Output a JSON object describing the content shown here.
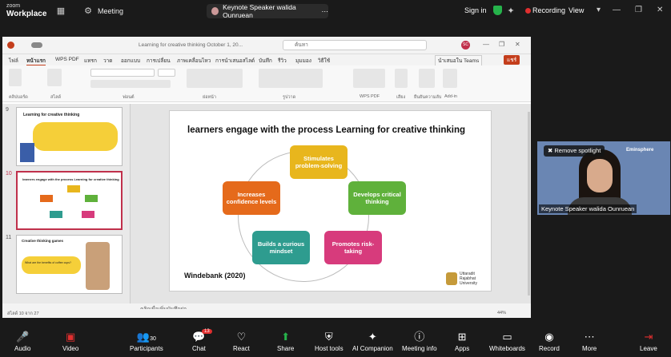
{
  "zoom": {
    "app_line1": "zoom",
    "app_line2": "Workplace",
    "meeting_label": "Meeting",
    "share_title": "Keynote Speaker walida Ounruean",
    "sign_in": "Sign in",
    "recording": "Recording",
    "view": "View",
    "colors": {
      "record": "#e02f2f",
      "shield": "#26b34b"
    }
  },
  "ppt": {
    "window_title": "Learning for creative thinking  October 1, 20...",
    "search_placeholder": "ค้นหา",
    "account_initials": "SC",
    "tabs": [
      "ไฟล์",
      "หน้าแรก",
      "WPS PDF",
      "แทรก",
      "วาด",
      "ออกแบบ",
      "การเปลี่ยน",
      "ภาพเคลื่อนไหว",
      "การนำเสนอสไลด์",
      "บันทึก",
      "รีวิว",
      "มุมมอง",
      "วิธีใช้"
    ],
    "share_btn": "แชร์",
    "teams_btn": "นำเสนอใน Teams",
    "ribbon_groups": [
      "คลิปบอร์ด",
      "สไลด์",
      "ฟอนต์",
      "ย่อหน้า",
      "รูปวาด",
      "WPS PDF",
      "เสียง",
      "ยืนยันความลับ",
      "Add-in"
    ],
    "notes_placeholder": "คลิกเพื่อเพิ่มบันทึกย่อ",
    "status_left": "สไลด์ 10 จาก 27",
    "zoom_level": "44%"
  },
  "thumbnails": [
    {
      "num": "9",
      "title": "Learning for creative thinking"
    },
    {
      "num": "10",
      "title": "learners engage with the process  Learning for creative thinking"
    },
    {
      "num": "11",
      "title": "Creative thinking games",
      "q": "What are the benefits of coffee cups?"
    }
  ],
  "slide": {
    "title": "learners engage with the process  Learning for creative thinking",
    "boxes": [
      {
        "label": "Stimulates problem-solving",
        "color": "#e8b61d"
      },
      {
        "label": "Develops critical thinking",
        "color": "#5fb13b"
      },
      {
        "label": "Promotes risk-taking",
        "color": "#d73b7c"
      },
      {
        "label": "Builds a curious mindset",
        "color": "#2e9c8f"
      },
      {
        "label": "Increases confidence levels",
        "color": "#e56a1b"
      }
    ],
    "citation": "Windebank (2020)",
    "university": "Uttaradit Rajabhat University"
  },
  "speaker": {
    "remove_spotlight": "Remove spotlight",
    "name": "Keynote Speaker walida Ounruean",
    "backdrop_text": "Eminsphere"
  },
  "toolbar": {
    "audio": "Audio",
    "video": "Video",
    "participants": "Participants",
    "participants_count": "30",
    "chat": "Chat",
    "chat_badge": "13",
    "react": "React",
    "share": "Share",
    "host_tools": "Host tools",
    "ai_companion": "AI Companion",
    "meeting_info": "Meeting info",
    "apps": "Apps",
    "whiteboards": "Whiteboards",
    "record": "Record",
    "more": "More",
    "leave": "Leave"
  }
}
